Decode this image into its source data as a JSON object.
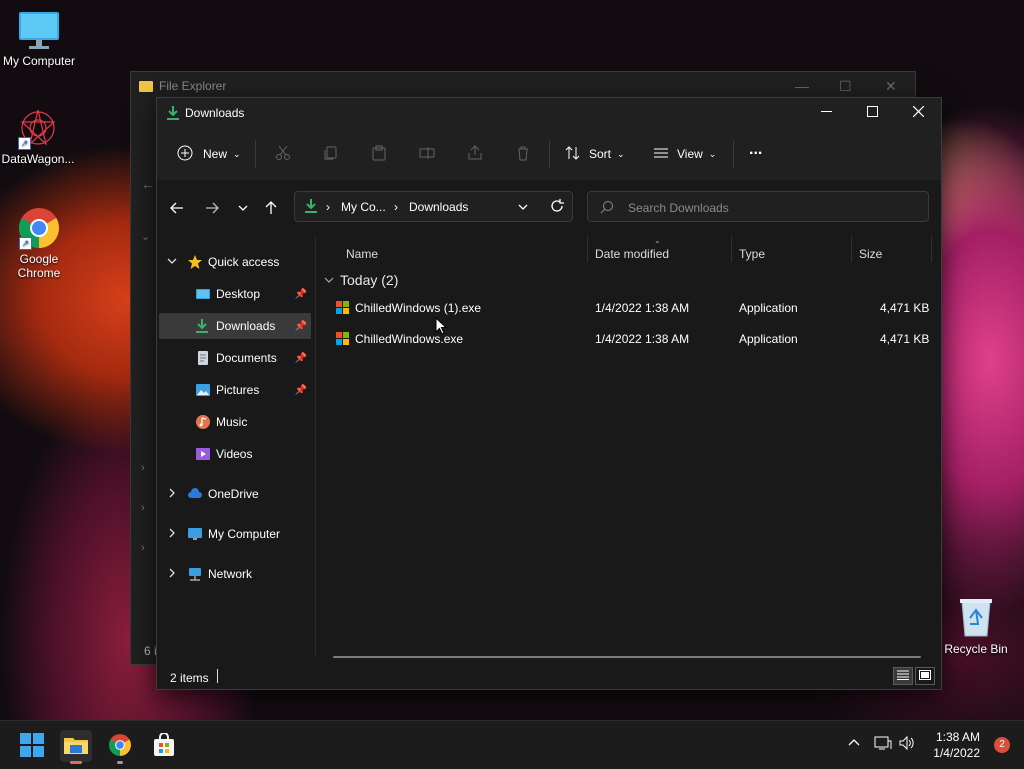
{
  "desktop": {
    "icons": [
      {
        "label": "My Computer",
        "icon": "monitor-icon"
      },
      {
        "label": "DataWagon...",
        "icon": "datawagon-app-icon"
      },
      {
        "label": "Google Chrome",
        "icon": "chrome-icon"
      }
    ],
    "recycle_bin": {
      "label": "Recycle Bin",
      "icon": "recycle-bin-icon"
    }
  },
  "background_window": {
    "title": "File Explorer",
    "footer_fragment": "6 i"
  },
  "window": {
    "title": "Downloads",
    "controls": {
      "minimize": "minimize",
      "maximize": "maximize",
      "close": "close"
    }
  },
  "toolbar": {
    "new_label": "New",
    "sort_label": "Sort",
    "view_label": "View",
    "more_label": "..."
  },
  "address": {
    "segments": [
      "My Co...",
      "Downloads"
    ],
    "separator": "›"
  },
  "search": {
    "placeholder": "Search Downloads"
  },
  "sidebar": {
    "quick_access": "Quick access",
    "items": [
      {
        "label": "Desktop",
        "pinned": true
      },
      {
        "label": "Downloads",
        "pinned": true,
        "selected": true
      },
      {
        "label": "Documents",
        "pinned": true
      },
      {
        "label": "Pictures",
        "pinned": true
      },
      {
        "label": "Music",
        "pinned": false
      },
      {
        "label": "Videos",
        "pinned": false
      }
    ],
    "roots": [
      {
        "label": "OneDrive"
      },
      {
        "label": "My Computer"
      },
      {
        "label": "Network"
      }
    ]
  },
  "columns": {
    "name": "Name",
    "date_modified": "Date modified",
    "type": "Type",
    "size": "Size"
  },
  "group": {
    "label": "Today (2)"
  },
  "files": [
    {
      "name": "ChilledWindows (1).exe",
      "date": "1/4/2022 1:38 AM",
      "type": "Application",
      "size": "4,471 KB"
    },
    {
      "name": "ChilledWindows.exe",
      "date": "1/4/2022 1:38 AM",
      "type": "Application",
      "size": "4,471 KB"
    }
  ],
  "status": {
    "item_count": "2 items"
  },
  "taskbar": {
    "time": "1:38 AM",
    "date": "1/4/2022",
    "notification_count": "2"
  },
  "colors": {
    "accent_green": "#3bb26a",
    "folder_yellow": "#f2c744",
    "window_bg": "#191919"
  }
}
